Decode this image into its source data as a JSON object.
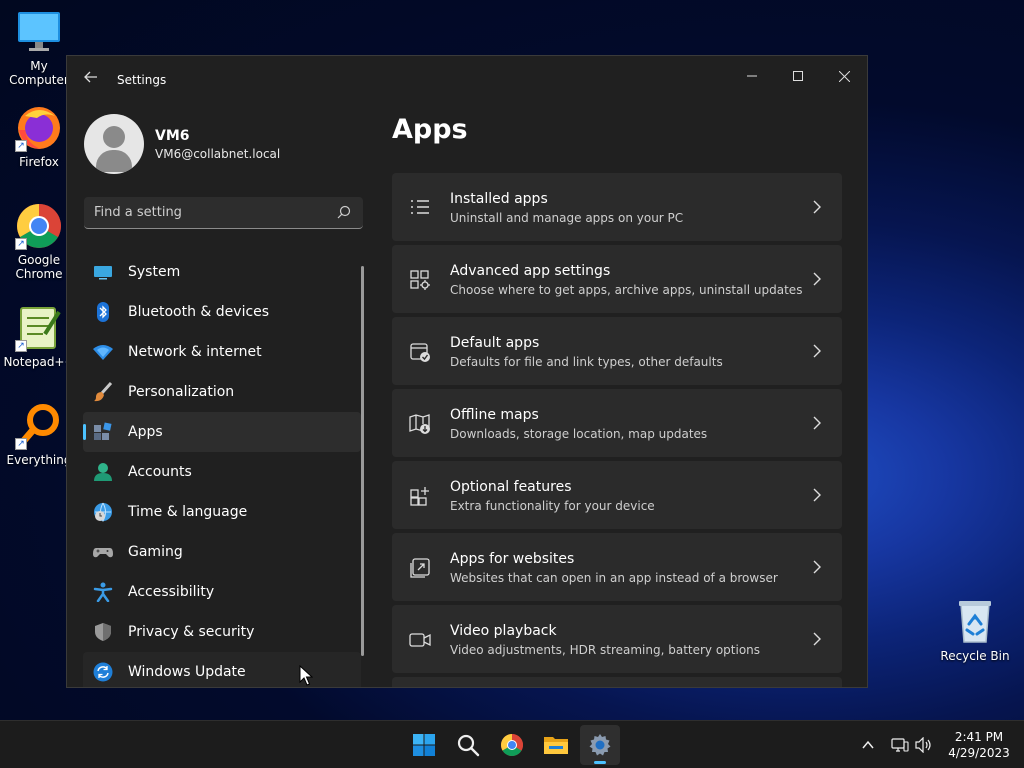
{
  "desktop": {
    "icons": [
      {
        "label": "My Computer",
        "icon": "monitor-icon"
      },
      {
        "label": "Firefox",
        "icon": "firefox-icon"
      },
      {
        "label": "Google Chrome",
        "icon": "chrome-icon"
      },
      {
        "label": "Notepad++",
        "icon": "notepad-plus-plus-icon"
      },
      {
        "label": "Everything",
        "icon": "everything-search-icon"
      }
    ],
    "recycle_bin": {
      "label": "Recycle Bin",
      "icon": "recycle-bin-icon"
    }
  },
  "window": {
    "title": "Settings",
    "controls": {
      "minimize": "minimize-icon",
      "maximize": "maximize-icon",
      "close": "close-icon"
    }
  },
  "profile": {
    "name": "VM6",
    "email": "VM6@collabnet.local"
  },
  "search": {
    "placeholder": "Find a setting"
  },
  "nav": {
    "items": [
      {
        "label": "System",
        "icon": "system-icon"
      },
      {
        "label": "Bluetooth & devices",
        "icon": "bluetooth-icon"
      },
      {
        "label": "Network & internet",
        "icon": "network-icon"
      },
      {
        "label": "Personalization",
        "icon": "brush-icon"
      },
      {
        "label": "Apps",
        "icon": "apps-icon",
        "active": true
      },
      {
        "label": "Accounts",
        "icon": "accounts-icon"
      },
      {
        "label": "Time & language",
        "icon": "time-language-icon"
      },
      {
        "label": "Gaming",
        "icon": "gamepad-icon"
      },
      {
        "label": "Accessibility",
        "icon": "accessibility-icon"
      },
      {
        "label": "Privacy & security",
        "icon": "shield-icon"
      },
      {
        "label": "Windows Update",
        "icon": "windows-update-icon"
      }
    ]
  },
  "main": {
    "title": "Apps",
    "cards": [
      {
        "title": "Installed apps",
        "subtitle": "Uninstall and manage apps on your PC",
        "icon": "list-icon"
      },
      {
        "title": "Advanced app settings",
        "subtitle": "Choose where to get apps, archive apps, uninstall updates",
        "icon": "app-settings-icon"
      },
      {
        "title": "Default apps",
        "subtitle": "Defaults for file and link types, other defaults",
        "icon": "default-apps-icon"
      },
      {
        "title": "Offline maps",
        "subtitle": "Downloads, storage location, map updates",
        "icon": "map-icon"
      },
      {
        "title": "Optional features",
        "subtitle": "Extra functionality for your device",
        "icon": "optional-features-icon"
      },
      {
        "title": "Apps for websites",
        "subtitle": "Websites that can open in an app instead of a browser",
        "icon": "open-in-app-icon"
      },
      {
        "title": "Video playback",
        "subtitle": "Video adjustments, HDR streaming, battery options",
        "icon": "video-icon"
      }
    ]
  },
  "taskbar": {
    "apps": [
      "start-icon",
      "search-icon",
      "chrome-icon",
      "file-explorer-icon",
      "settings-gear-icon"
    ],
    "active_app": "settings-gear-icon",
    "tray": [
      "chevron-up-icon",
      "network-icon",
      "volume-icon"
    ],
    "time": "2:41 PM",
    "date": "4/29/2023"
  },
  "colors": {
    "accent": "#4cc2ff",
    "window_bg": "#202020",
    "card_bg": "#2b2b2b"
  }
}
